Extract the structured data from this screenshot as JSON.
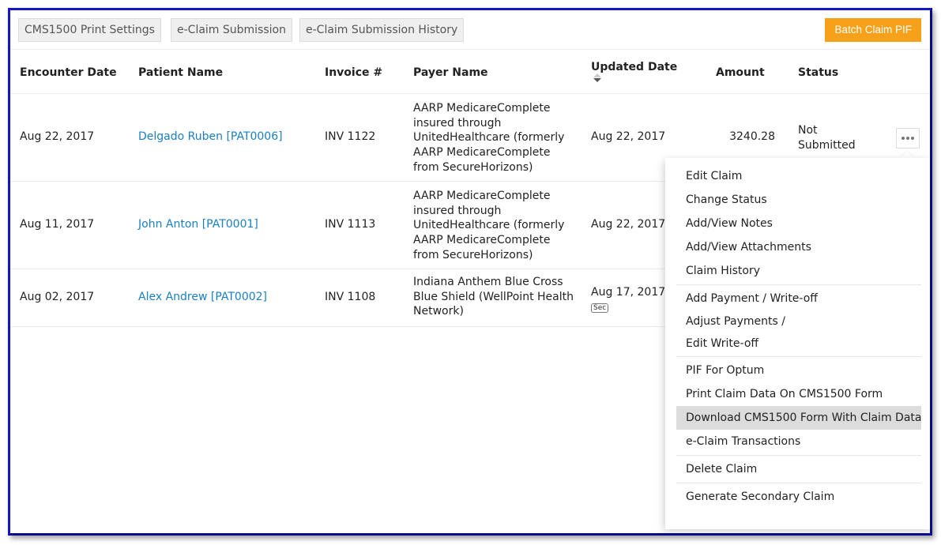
{
  "toolbar": {
    "tabs": [
      {
        "label": "CMS1500 Print Settings"
      },
      {
        "label": "e-Claim Submission"
      },
      {
        "label": "e-Claim Submission History"
      }
    ],
    "batch_button": "Batch Claim PIF",
    "batch_color": "#f7a11a"
  },
  "table": {
    "headers": {
      "encounter_date": "Encounter Date",
      "patient_name": "Patient Name",
      "invoice": "Invoice #",
      "payer_name": "Payer Name",
      "updated_date": "Updated Date",
      "amount": "Amount",
      "status": "Status"
    },
    "sort_icon": "sort-desc-icon",
    "rows": [
      {
        "encounter_date": "Aug 22, 2017",
        "patient": "Delgado Ruben [PAT0006]",
        "invoice": "INV 1122",
        "payer": "AARP MedicareComplete insured through UnitedHealthcare (formerly AARP MedicareComplete from SecureHorizons)",
        "updated_date": "Aug 22, 2017",
        "amount": "3240.28",
        "status": "Not Submitted"
      },
      {
        "encounter_date": "Aug 11, 2017",
        "patient": "John Anton [PAT0001]",
        "invoice": "INV 1113",
        "payer": "AARP MedicareComplete insured through UnitedHealthcare (formerly AARP MedicareComplete from SecureHorizons)",
        "updated_date": "Aug 22, 2017"
      },
      {
        "encounter_date": "Aug 02, 2017",
        "patient": "Alex Andrew [PAT0002]",
        "invoice": "INV 1108",
        "payer": "Indiana Anthem Blue Cross Blue Shield (WellPoint Health Network)",
        "updated_date": "Aug 17, 2017",
        "badge": "Sec"
      }
    ]
  },
  "menu": {
    "items": [
      "Edit Claim",
      "Change Status",
      "Add/View Notes",
      "Add/View Attachments",
      "Claim History",
      "Add Payment / Write-off",
      "Adjust Payments /",
      "Edit Write-off",
      "PIF For Optum",
      "Print Claim Data On CMS1500 Form",
      "Download CMS1500 Form With Claim Data",
      "e-Claim Transactions",
      "Delete Claim",
      "Generate Secondary Claim"
    ],
    "highlighted": "Download CMS1500 Form With Claim Data"
  },
  "link_color": "#1a7fc1"
}
